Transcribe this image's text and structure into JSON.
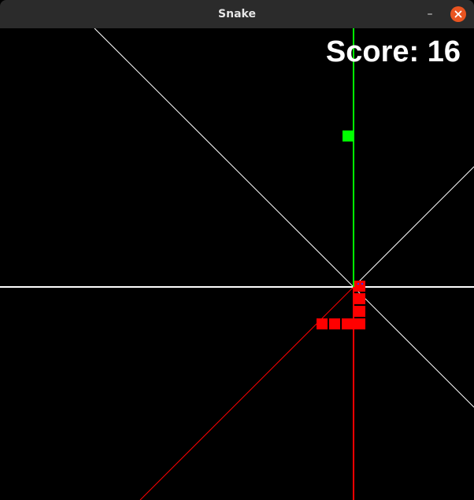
{
  "window": {
    "title": "Snake",
    "minimize_glyph": "–",
    "close_icon": "close-icon"
  },
  "hud": {
    "score_label": "Score: 16"
  },
  "game": {
    "grid_cell_units": 16,
    "food": {
      "col": 27,
      "row": 8,
      "color": "#00ff00"
    },
    "snake": {
      "color": "#ff0000",
      "eye_color": "#3333ff",
      "segments": [
        {
          "col": 28,
          "row": 20,
          "head": true
        },
        {
          "col": 28,
          "row": 21
        },
        {
          "col": 28,
          "row": 22
        },
        {
          "col": 28,
          "row": 23
        },
        {
          "col": 27,
          "row": 23
        },
        {
          "col": 26,
          "row": 23
        },
        {
          "col": 25,
          "row": 23
        }
      ]
    },
    "colors": {
      "background": "#000000",
      "vertical_up": "#00ff00",
      "vertical_down": "#ff0000",
      "horizontal": "#ffffff",
      "diag_up_left": "#ffffff",
      "diag_up_right": "#ffffff",
      "diag_down_right": "#ffffff",
      "diag_down_left": "#ff0000"
    }
  }
}
